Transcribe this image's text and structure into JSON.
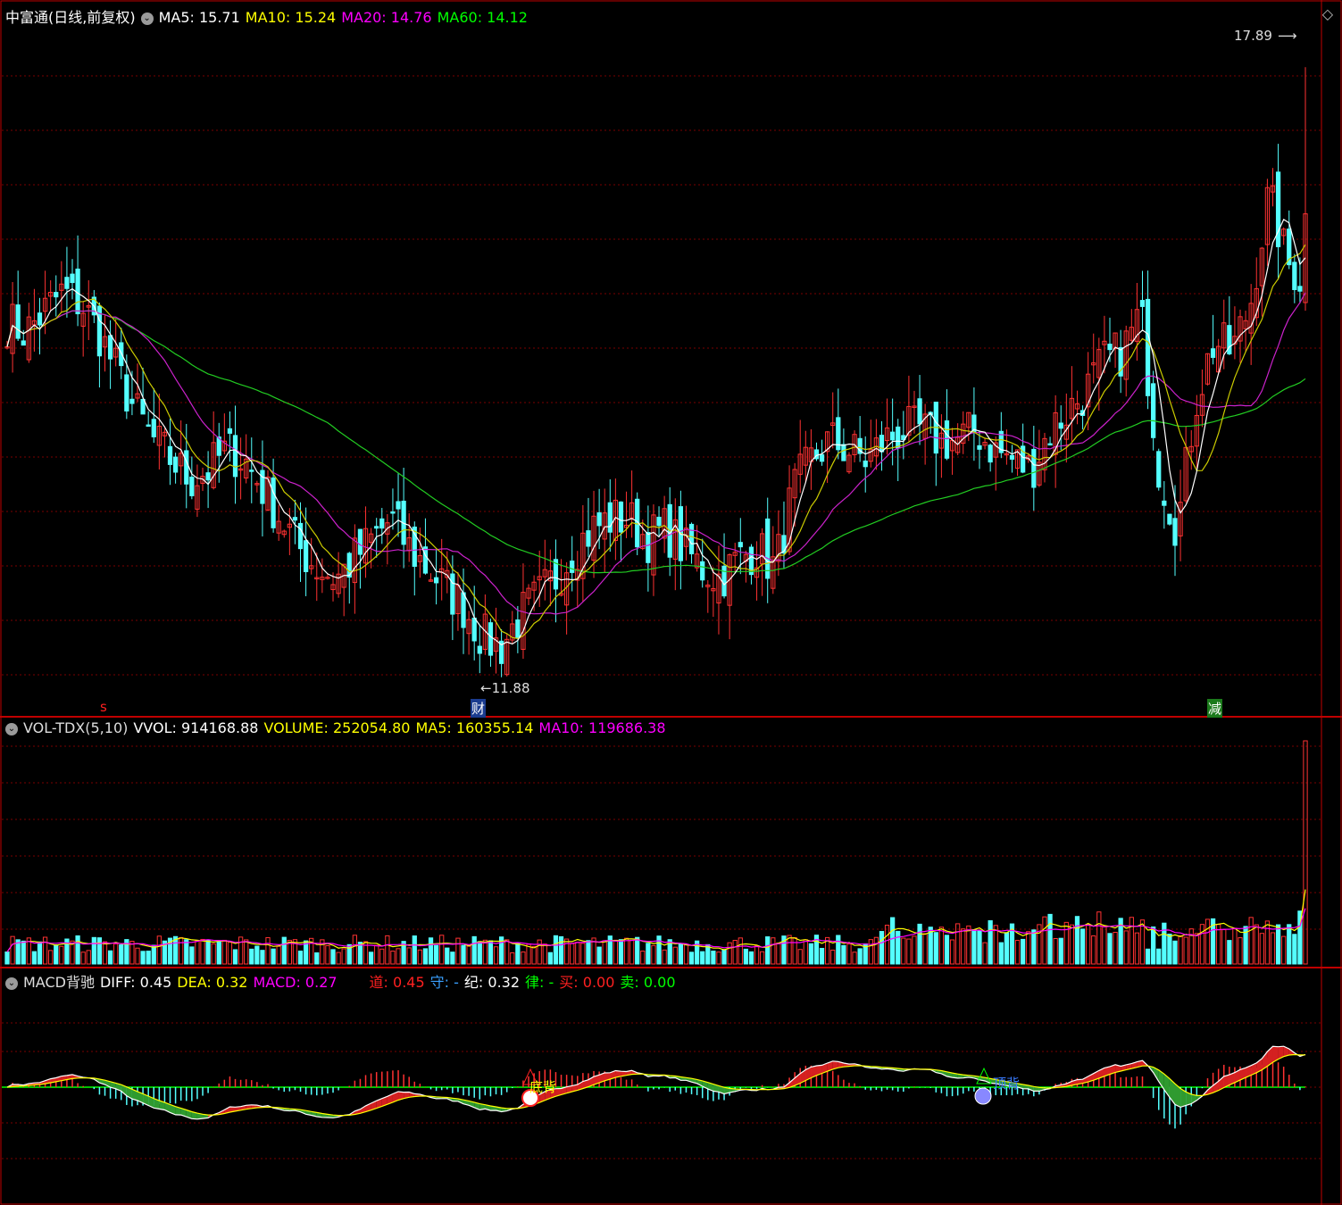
{
  "main_panel": {
    "title": "中富通(日线,前复权)",
    "ma_labels": [
      {
        "name": "MA5:",
        "value": "15.71",
        "color": "#ffffff"
      },
      {
        "name": "MA10:",
        "value": "15.24",
        "color": "#ffff00"
      },
      {
        "name": "MA20:",
        "value": "14.76",
        "color": "#ff00ff"
      },
      {
        "name": "MA60:",
        "value": "14.12",
        "color": "#00ff00"
      }
    ],
    "high_label": "17.89",
    "low_label": "11.88",
    "markers": {
      "s_label": "s",
      "cai_label": "财",
      "jian_label": "减"
    }
  },
  "vol_panel": {
    "name": "VOL-TDX(5,10)",
    "labels": [
      {
        "name": "VVOL:",
        "value": "914168.88",
        "color": "#ffffff"
      },
      {
        "name": "VOLUME:",
        "value": "252054.80",
        "color": "#ffff00"
      },
      {
        "name": "MA5:",
        "value": "160355.14",
        "color": "#ffff00"
      },
      {
        "name": "MA10:",
        "value": "119686.38",
        "color": "#ff00ff"
      }
    ]
  },
  "macd_panel": {
    "name": "MACD背驰",
    "labels": [
      {
        "name": "DIFF:",
        "value": "0.45",
        "color": "#ffffff"
      },
      {
        "name": "DEA:",
        "value": "0.32",
        "color": "#ffff00"
      },
      {
        "name": "MACD:",
        "value": "0.27",
        "color": "#ff00ff"
      }
    ],
    "labels2": [
      {
        "name": "道:",
        "value": "0.45",
        "color": "#ff2020"
      },
      {
        "name": "守:",
        "value": "-",
        "color": "#3aa0ff"
      },
      {
        "name": "纪:",
        "value": "0.32",
        "color": "#ffffff"
      },
      {
        "name": "律:",
        "value": "-",
        "color": "#00ff00"
      },
      {
        "name": "买:",
        "value": "0.00",
        "color": "#ff2020"
      },
      {
        "name": "卖:",
        "value": "0.00",
        "color": "#00ff00"
      }
    ],
    "signal_text_1": "底背",
    "signal_text_2": "顶背"
  },
  "colors": {
    "up": "#ff3232",
    "down": "#54ffff",
    "grid": "#7a0000",
    "frame": "#c00000",
    "zero": "#00ff00"
  },
  "chart_data": {
    "type": "candlestick",
    "price_range": [
      11.5,
      18.3
    ],
    "highest": 17.89,
    "lowest": 11.88,
    "close_trend": [
      15.3,
      15.2,
      15.4,
      15.6,
      15.5,
      15.2,
      14.8,
      14.4,
      14.1,
      13.9,
      13.7,
      13.8,
      14.0,
      13.9,
      13.6,
      13.3,
      13.0,
      12.8,
      12.7,
      12.9,
      13.1,
      13.3,
      13.0,
      12.8,
      12.6,
      12.4,
      12.1,
      12.0,
      12.3,
      12.5,
      12.7,
      13.0,
      13.2,
      13.3,
      13.3,
      13.1,
      13.2,
      13.0,
      12.8,
      12.7,
      12.9,
      13.0,
      12.8,
      13.6,
      13.9,
      14.1,
      14.0,
      13.9,
      14.1,
      14.2,
      14.2,
      14.1,
      14.1,
      14.2,
      14.0,
      13.9,
      13.8,
      14.2,
      14.4,
      14.6,
      14.9,
      15.0,
      15.4,
      13.8,
      13.2,
      14.5,
      15.1,
      15.0,
      15.5,
      16.6,
      15.9,
      15.7
    ],
    "ma5": "15.71",
    "ma10": "15.24",
    "ma20": "14.76",
    "ma60": "14.12",
    "volume": {
      "vvol": "914168.88",
      "volume": "252054.80",
      "ma5": "160355.14",
      "ma10": "119686.38"
    },
    "macd": {
      "diff": "0.45",
      "dea": "0.32",
      "macd": "0.27"
    }
  }
}
